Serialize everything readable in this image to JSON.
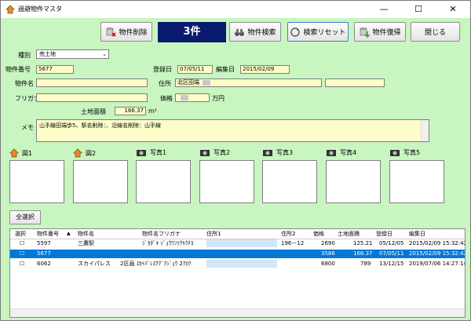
{
  "window": {
    "title": "過避物件マスタ",
    "minimize": "—",
    "maximize": "☐",
    "close": "✕"
  },
  "toolbar": {
    "delete": "物件削除",
    "count": "3件",
    "search": "物件検索",
    "reset": "検索リセット",
    "restore": "物件復帰",
    "close": "閉じる"
  },
  "form": {
    "type_label": "種別",
    "type_value": "売土地",
    "id_label": "物件番号",
    "id_value": "5677",
    "reg_label": "登録日",
    "reg_value": "07/05/11",
    "edit_label": "編集日",
    "edit_value": "2015/02/09",
    "name_label": "物件名",
    "name_value": "",
    "addr_label": "住所",
    "addr_value": "北区田端",
    "kana_label": "フリガナ",
    "kana_value": "",
    "price_label": "価格",
    "price_unit": "万円",
    "area_label": "土地面積",
    "area_value": "166.37",
    "area_unit": "m²",
    "memo_label": "メモ",
    "memo_value": "山手線田端歩5、駅名削除：、沿線名削除：山手線"
  },
  "photos": [
    "図1",
    "図2",
    "写真1",
    "写真2",
    "写真3",
    "写真4",
    "写真5"
  ],
  "select_all": "全選択",
  "grid": {
    "headers": [
      "選択",
      "物件番号",
      "物件名",
      "物件名フリガナ",
      "住所1",
      "住所2",
      "価格",
      "土地面積",
      "登録日",
      "編集日"
    ],
    "rows": [
      [
        "☐",
        "5597",
        "三鷹駅",
        "ｼﾞｶﾀﾞｷ ｼﾞｮｳﾜﾝﾂｸｷｸﾁﾖ",
        "",
        "196－12",
        "2690",
        "125.21",
        "05/12/05",
        "2015/02/09 15:32:42"
      ],
      [
        "☐",
        "5677",
        "",
        "",
        "",
        "",
        "3586",
        "166.37",
        "07/05/11",
        "2015/02/09 15:32:42"
      ],
      [
        "☐",
        "6062",
        "スカイパレス",
        "2区画 ｽｶｲﾊﾟﾚｽｸｸﾞｸｼﾞｮｳ 2ｸｶｸ",
        "",
        "",
        "6800",
        "789",
        "13/12/15",
        "2019/07/06 14:27:14"
      ]
    ]
  }
}
